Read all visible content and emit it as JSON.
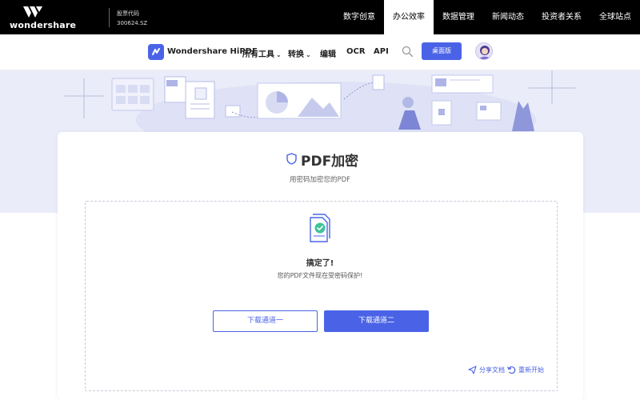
{
  "topbar": {
    "brand": "wondershare",
    "stock_label": "股票代码",
    "stock_code": "300624.SZ",
    "nav": [
      "数字创意",
      "办公效率",
      "数据管理",
      "新闻动态",
      "投资者关系",
      "全球站点"
    ],
    "active_index": 1
  },
  "product_nav": {
    "name": "Wondershare HiPDF",
    "items": [
      {
        "label": "所有工具",
        "dropdown": true
      },
      {
        "label": "转换",
        "dropdown": true
      },
      {
        "label": "编辑",
        "dropdown": false
      },
      {
        "label": "OCR",
        "dropdown": false
      },
      {
        "label": "API",
        "dropdown": false
      }
    ],
    "desktop_button": "桌面版"
  },
  "card": {
    "title": "PDF加密",
    "subtitle": "用密码加密您的PDF",
    "done_title": "搞定了!",
    "done_subtitle": "您的PDF文件现在受密码保护!",
    "download_1": "下载通道一",
    "download_2": "下载通道二",
    "share": "分享文档",
    "restart": "重新开始"
  },
  "colors": {
    "accent": "#4a63e6",
    "topbar": "#000000",
    "banner": "#eaecf9"
  },
  "icons": [
    "wondershare-logo-icon",
    "hipdf-logo-icon",
    "search-icon",
    "shield-icon",
    "pdf-file-check-icon",
    "share-icon",
    "restart-icon"
  ]
}
